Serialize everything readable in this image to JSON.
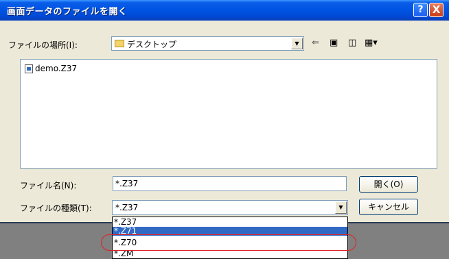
{
  "window": {
    "title": "画面データのファイルを開く",
    "help_symbol": "?",
    "close_symbol": "X"
  },
  "lookin": {
    "label": "ファイルの場所(I):",
    "value": "デスクトップ",
    "icons": [
      "back-arrow-icon",
      "up-folder-icon",
      "new-folder-icon",
      "view-menu-icon"
    ]
  },
  "files": [
    {
      "name": "demo.Z37",
      "icon": "file-icon"
    }
  ],
  "filename": {
    "label": "ファイル名(N):",
    "value": "*.Z37"
  },
  "filetype": {
    "label": "ファイルの種類(T):",
    "value": "*.Z37",
    "options": [
      "*.Z37",
      "*.Z71",
      "*.Z70",
      "*.ZM"
    ],
    "highlighted_index": 1,
    "circled_index": 2
  },
  "buttons": {
    "open": "開く(O)",
    "cancel": "キャンセル"
  },
  "colors": {
    "title_blue": "#0054e3",
    "selection_blue": "#316ac5",
    "circle_red": "#e02020"
  }
}
